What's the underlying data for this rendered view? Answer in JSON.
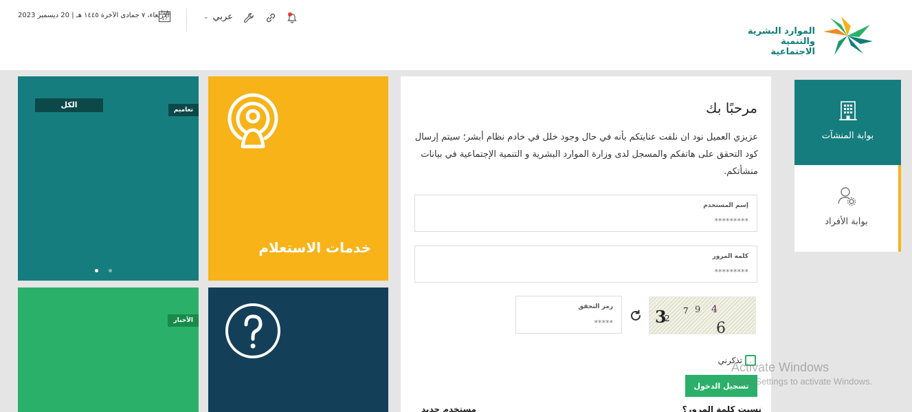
{
  "header": {
    "date": "الأربعاء، ٧ جمادى الآخرة ١٤٤٥ هـ | 20 ديسمبر 2023",
    "calendar_day": "17",
    "language": "عربي",
    "logo_line1": "الموارد البشرية",
    "logo_line2": "والتنمية الاجتماعية",
    "icons": [
      "calendar-icon",
      "chevron-down-icon",
      "wrench-icon",
      "link-icon",
      "bell-icon"
    ]
  },
  "tiles": {
    "all_label": "الكل",
    "announcements_tag": "تعاميم",
    "inquiry_label": "خدمات الاستعلام",
    "news_tag": "الأخبار",
    "colors": {
      "teal": "#167d7f",
      "yellow": "#f7b318",
      "green": "#2bb06a",
      "navy": "#143f59"
    }
  },
  "login": {
    "welcome": "مرحبًا بك",
    "notice": "عزيزي العميل نود ان نلفت عنايتكم بأنه في حال وجود خلل في خادم نظام أبشر؛ سيتم إرسال كود التحقق على هاتفكم والمسجل لدى وزارة الموارد البشرية و التنمية الإجتماعية في بيانات منشأتكم.",
    "username_label": "إسم المستخدم",
    "username_placeholder": "*********",
    "password_label": "كلمة المرور",
    "password_placeholder": "*********",
    "captcha_label": "رمز التحقق",
    "captcha_placeholder": "*****",
    "captcha_chars": [
      "3",
      "2",
      "7",
      "9",
      "4",
      "6"
    ],
    "remember_label": "تذكرني",
    "login_button": "تسجيل الدخول",
    "forgot_password": "نسيت كلمة المرور؟",
    "new_user": "مستخدم جديد"
  },
  "portals": {
    "establishments": "بوابة المنشآت",
    "individuals": "بوابة الأفراد"
  },
  "watermark": {
    "title": "Activate Windows",
    "subtitle": "Go to Settings to activate Windows."
  }
}
